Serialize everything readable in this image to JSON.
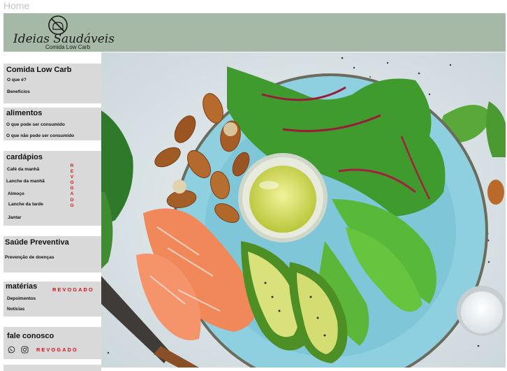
{
  "page": {
    "home_label": "Home"
  },
  "brand": {
    "title": "Ideias Saudáveis",
    "subtitle": "Comida Low Carb"
  },
  "sidebar": {
    "sections": [
      {
        "title": "Comida Low Carb",
        "links": [
          "O que é?",
          "Benefícios"
        ]
      },
      {
        "title": "alimentos",
        "links": [
          "O que pode ser consumido",
          "O que não pode ser consumido"
        ]
      },
      {
        "title": "cardápios",
        "links": [
          "Café da manhã",
          "Lanche da manhã",
          "Almoço",
          "Lanche da tarde",
          "Jantar"
        ],
        "stamp": "REVOGADO"
      },
      {
        "title": "Saúde Preventiva",
        "links": [
          "Prevenção de doenças"
        ]
      },
      {
        "title": "matérias",
        "links": [
          "Depoimentos",
          "Notícias"
        ],
        "stamp": "REVOGADO"
      },
      {
        "title": "fale conosco",
        "icons": [
          "whatsapp-icon",
          "instagram-icon"
        ],
        "stamp": "REVOGADO"
      }
    ]
  },
  "hero": {
    "icons": [
      "salad-plate-photo"
    ]
  },
  "colors": {
    "banner": "#a6b9a6",
    "panel": "#d9d9d9",
    "stamp": "#e0101a",
    "plate": "#8fd0e0"
  }
}
